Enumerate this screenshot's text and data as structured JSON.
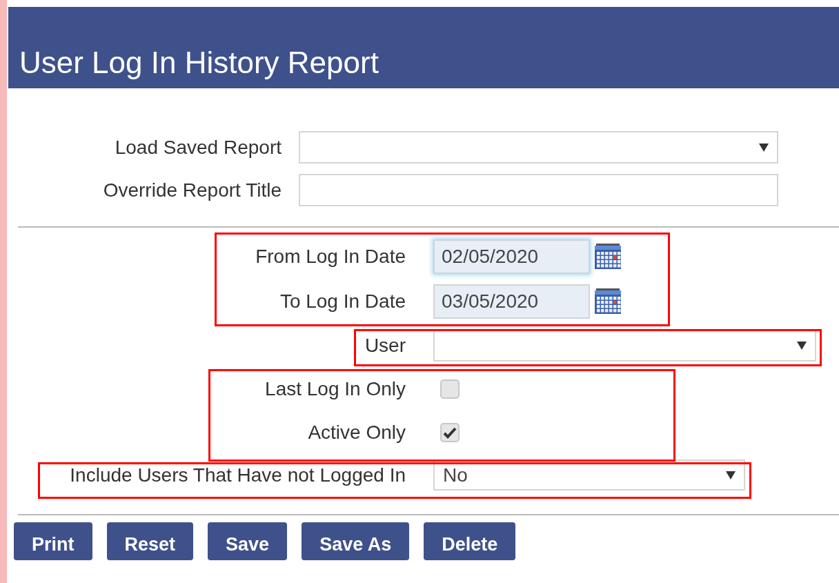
{
  "page": {
    "title": "User Log In History Report"
  },
  "report_fields": [
    {
      "kind": "select",
      "label": "Load Saved Report"
    },
    {
      "kind": "text",
      "label": "Override Report Title"
    }
  ],
  "filters": [
    {
      "kind": "date",
      "label": "From Log In Date",
      "value": "02/05/2020",
      "focused": true
    },
    {
      "kind": "date",
      "label": "To Log In Date",
      "value": "03/05/2020",
      "focused": false
    },
    {
      "kind": "select",
      "label": "User"
    },
    {
      "kind": "checkbox",
      "label": "Last Log In Only",
      "checked": false
    },
    {
      "kind": "checkbox",
      "label": "Active Only",
      "checked": true
    },
    {
      "kind": "select",
      "label": "Include Users That Have not Logged In",
      "value": "No"
    }
  ],
  "buttons": [
    "Print",
    "Reset",
    "Save",
    "Save As",
    "Delete"
  ]
}
